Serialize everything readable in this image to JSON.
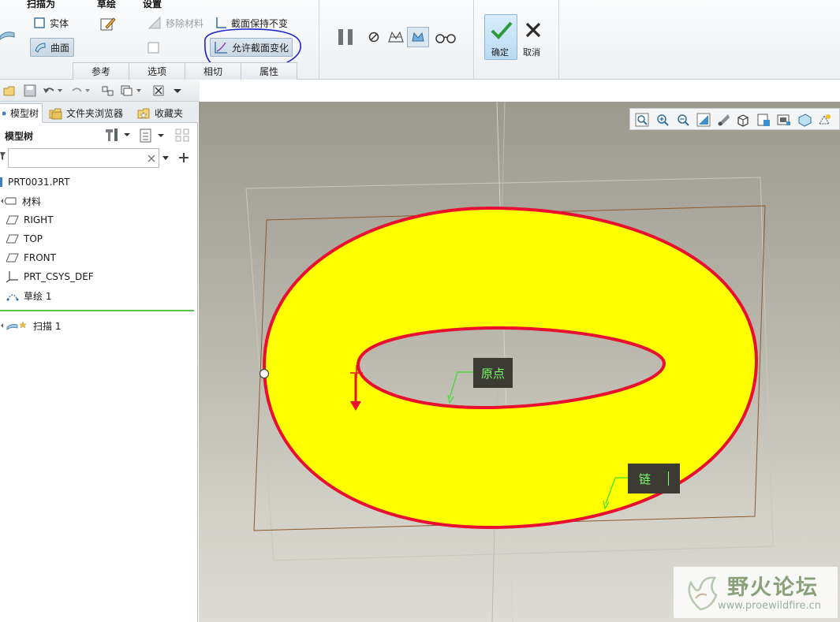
{
  "ribbon": {
    "groups": {
      "sweep_as": "扫描为",
      "sketch": "草绘",
      "settings": "设置"
    },
    "buttons": {
      "solid": "实体",
      "surface": "曲面",
      "remove_material": "移除材料",
      "constant_section": "截面保持不变",
      "variable_section": "允许截面变化",
      "ok": "确定",
      "cancel": "取消"
    },
    "tabs": [
      "参考",
      "选项",
      "相切",
      "属性"
    ],
    "highlight_color": "#1b24c8"
  },
  "panel": {
    "tabs": {
      "model_tree": "模型树",
      "folder_browser": "文件夹浏览器",
      "favorites": "收藏夹"
    },
    "tree_header": "模型树",
    "search": {
      "value": "",
      "placeholder": ""
    },
    "tree": [
      {
        "label": "PRT0031.PRT",
        "icon": "part-icon"
      },
      {
        "label": "材料",
        "icon": "material-icon"
      },
      {
        "label": "RIGHT",
        "icon": "datum-plane-icon"
      },
      {
        "label": "TOP",
        "icon": "datum-plane-icon"
      },
      {
        "label": "FRONT",
        "icon": "datum-plane-icon"
      },
      {
        "label": "PRT_CSYS_DEF",
        "icon": "csys-icon"
      },
      {
        "label": "草绘 1",
        "icon": "sketch-icon"
      },
      {
        "label": "扫描 1",
        "icon": "sweep-icon"
      }
    ]
  },
  "viewport": {
    "labels": {
      "origin": "原点",
      "chain": "链"
    },
    "colors": {
      "surface": "#ffff00",
      "edge": "#e8102e",
      "tag_text": "#7cff6a",
      "datum": "#8a5a2c"
    }
  },
  "watermark": {
    "title": "野火论坛",
    "url": "www.proewildfire.cn"
  }
}
